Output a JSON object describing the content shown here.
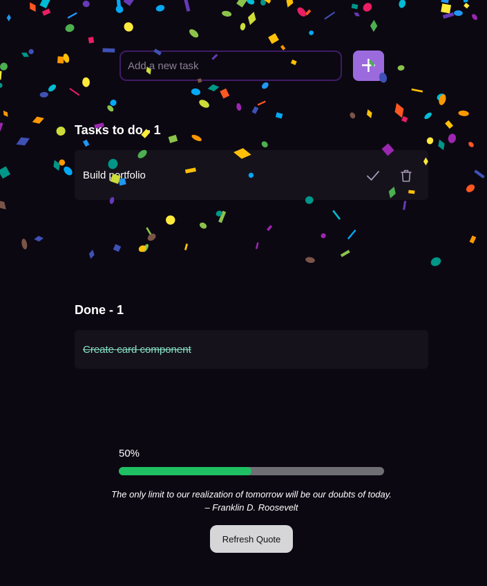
{
  "add_task": {
    "placeholder": "Add a new task",
    "value": "",
    "add_button_label": "+"
  },
  "todo": {
    "heading": "Tasks to do - 1",
    "tasks": [
      {
        "text": "Build portfolio",
        "complete_icon": "check-icon",
        "delete_icon": "trash-icon"
      }
    ]
  },
  "done": {
    "heading": "Done - 1",
    "tasks": [
      {
        "text": "Create card component"
      }
    ]
  },
  "progress": {
    "label": "50%",
    "fraction": 0.5
  },
  "quote": {
    "text": "The only limit to our realization of tomorrow will be our doubts of today. – Franklin D. Roosevelt"
  },
  "refresh_button_label": "Refresh Quote",
  "colors": {
    "background": "#0c0812",
    "accent": "#9b6bde",
    "input_border": "#3f1c66",
    "card": "#15121b",
    "progress_fill": "#1fbf63",
    "progress_track": "#706e75",
    "done_text": "#86e0c3",
    "icon": "#a89ab8"
  },
  "confetti_colors": [
    "#e91e63",
    "#9c27b0",
    "#673ab7",
    "#3f51b5",
    "#2196f3",
    "#03a9f4",
    "#00bcd4",
    "#009688",
    "#4caf50",
    "#8bc34a",
    "#cddc39",
    "#ffeb3b",
    "#ffc107",
    "#ff9800",
    "#ff5722",
    "#795548"
  ]
}
